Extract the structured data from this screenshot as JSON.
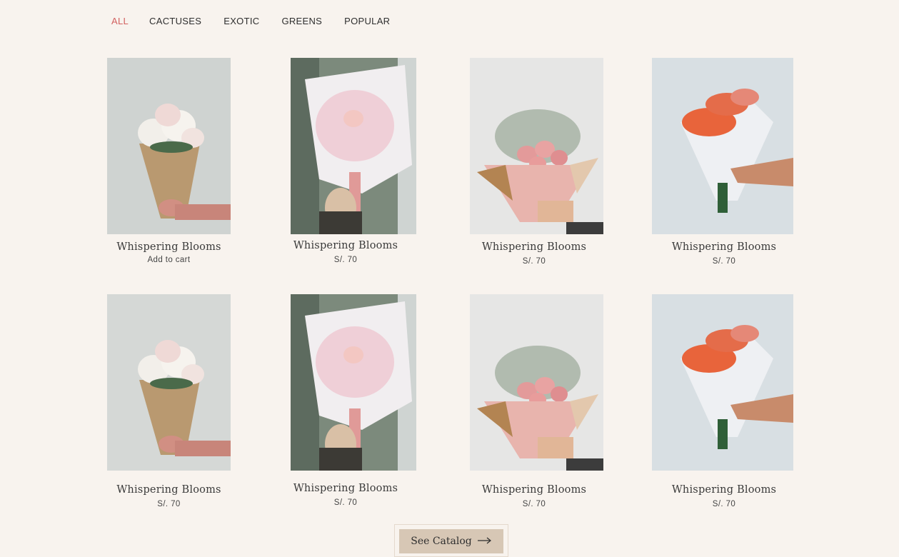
{
  "filters": [
    {
      "label": "ALL",
      "active": true
    },
    {
      "label": "CACTUSES",
      "active": false
    },
    {
      "label": "EXOTIC",
      "active": false
    },
    {
      "label": "GREENS",
      "active": false
    },
    {
      "label": "POPULAR",
      "active": false
    }
  ],
  "colors": {
    "background": "#f8f3ee",
    "active_tab": "#d2605f",
    "button": "#d7c7b5"
  },
  "products": [
    {
      "name": "Whispering Blooms",
      "sub": "Add to cart",
      "photo": "white-peonies-kraft-paper"
    },
    {
      "name": "Whispering Blooms",
      "sub": "S/. 70",
      "photo": "pink-babys-breath-white-wrap"
    },
    {
      "name": "Whispering Blooms",
      "sub": "S/. 70",
      "photo": "pink-carnations-pink-wrap"
    },
    {
      "name": "Whispering Blooms",
      "sub": "S/. 70",
      "photo": "orange-roses-white-paper"
    },
    {
      "name": "Whispering Blooms",
      "sub": "S/. 70",
      "photo": "white-peonies-kraft-paper"
    },
    {
      "name": "Whispering Blooms",
      "sub": "S/. 70",
      "photo": "pink-babys-breath-white-wrap"
    },
    {
      "name": "Whispering Blooms",
      "sub": "S/. 70",
      "photo": "pink-carnations-pink-wrap"
    },
    {
      "name": "Whispering Blooms",
      "sub": "S/. 70",
      "photo": "orange-roses-white-paper"
    }
  ],
  "cta": {
    "label": "See Catalog",
    "icon": "arrow-right-icon"
  }
}
